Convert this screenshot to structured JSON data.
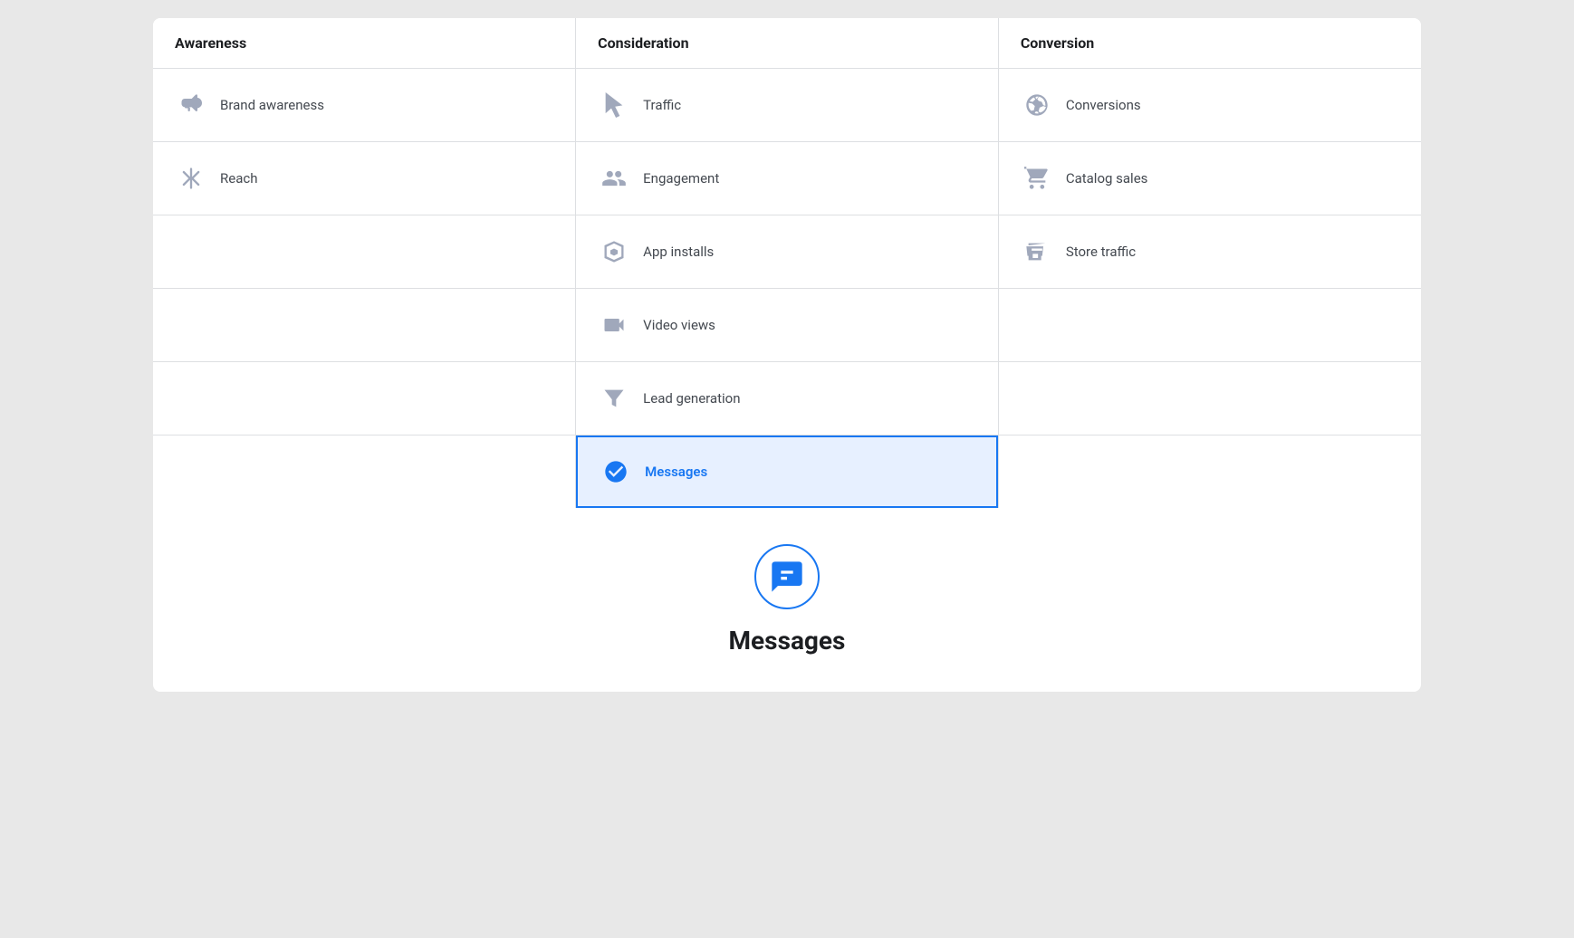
{
  "columns": {
    "awareness": {
      "header": "Awareness",
      "items": [
        {
          "id": "brand-awareness",
          "label": "Brand awareness",
          "icon": "megaphone"
        },
        {
          "id": "reach",
          "label": "Reach",
          "icon": "asterisk"
        }
      ]
    },
    "consideration": {
      "header": "Consideration",
      "items": [
        {
          "id": "traffic",
          "label": "Traffic",
          "icon": "cursor"
        },
        {
          "id": "engagement",
          "label": "Engagement",
          "icon": "people"
        },
        {
          "id": "app-installs",
          "label": "App installs",
          "icon": "box"
        },
        {
          "id": "video-views",
          "label": "Video views",
          "icon": "video"
        },
        {
          "id": "lead-generation",
          "label": "Lead generation",
          "icon": "filter"
        },
        {
          "id": "messages",
          "label": "Messages",
          "icon": "chat",
          "selected": true
        }
      ]
    },
    "conversion": {
      "header": "Conversion",
      "items": [
        {
          "id": "conversions",
          "label": "Conversions",
          "icon": "globe"
        },
        {
          "id": "catalog-sales",
          "label": "Catalog sales",
          "icon": "cart"
        },
        {
          "id": "store-traffic",
          "label": "Store traffic",
          "icon": "store"
        }
      ]
    }
  },
  "bottom": {
    "title": "Messages",
    "icon": "chat"
  },
  "colors": {
    "selected": "#1877f2",
    "selected_bg": "#e7f0ff",
    "icon_default": "#a0a8bb",
    "text_default": "#444950",
    "header_text": "#1c1e21"
  }
}
